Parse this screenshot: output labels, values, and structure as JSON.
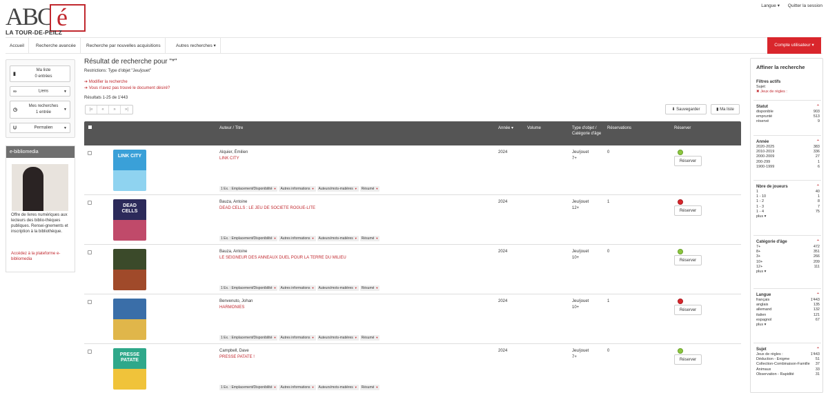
{
  "header": {
    "logo_text": "ABC",
    "logo_e": "é",
    "logo_subtitle": "LA TOUR-DE-PEILZ",
    "langue": "Langue ▾",
    "logout": "Quitter la session"
  },
  "nav": {
    "items": [
      "Accueil",
      "Recherche avancée",
      "Recherche par nouvelles acquisitions",
      "Autres recherches ▾"
    ],
    "account": "Compte utilisateur ▾"
  },
  "left": {
    "my_list_label": "Ma liste",
    "my_list_count": "0 entrées",
    "links": "Liens",
    "searches_label": "Mes recherches",
    "searches_count": "1 entrée",
    "permalink": "Permalien",
    "ebib_title": "e-bibliomedia",
    "ebib_text": "Offre de livres numériques aux lecteurs des biblio-thèques publiques. Rensei-gnements et inscription à la bibliothèque.",
    "ebib_link": "Accédez à la plateforme e-bibliomedia"
  },
  "main": {
    "title": "Résultat de recherche pour \"*\"",
    "restrictions": "Restrictions: Type d'objet \"Jeu/jouet\"",
    "modify": "➔ Modifier la recherche",
    "not_found": "➔ Vous n'avez pas trouvé le document désiré?",
    "results_count": "Résultats 1-25 de 1'443",
    "pager": [
      "|«",
      "«",
      "»",
      "»|"
    ],
    "save_btn": "⬇ Sauvegarder",
    "mylist_btn": "▮ Ma liste"
  },
  "table": {
    "headers": {
      "author": "Auteur / Titre",
      "year": "Année ▾",
      "volume": "Volume",
      "type": "Type d'objet / Catégorie d'âge",
      "reservations": "Réservations",
      "reserve": "Réserver"
    },
    "tag_labels": [
      "1 Ex. : Emplacement/Disponibilité",
      "Autres informations",
      "Auteurs/mots-matières",
      "Résumé"
    ],
    "reserve_btn": "Réserver",
    "rows": [
      {
        "author": "Alquier, Émilien",
        "title": "LINK CITY",
        "year": "2024",
        "type": "Jeu/jouet",
        "age": "7+",
        "res": "0",
        "status": "ok",
        "cover_text": "LINK CITY",
        "c1": "#3aa0d8",
        "c2": "#8fd3f0"
      },
      {
        "author": "Bauza, Antoine",
        "title": "DEAD CELLS : LE JEU DE SOCIETE ROGUE-LITE",
        "year": "2024",
        "type": "Jeu/jouet",
        "age": "12+",
        "res": "1",
        "status": "no",
        "cover_text": "DEAD CELLS",
        "c1": "#2c2a5a",
        "c2": "#c04a6a"
      },
      {
        "author": "Bauza, Antoine",
        "title": "LE SEIGNEUR DES ANNEAUX DUEL POUR LA TERRE DU MILIEU",
        "year": "2024",
        "type": "Jeu/jouet",
        "age": "10+",
        "res": "0",
        "status": "ok",
        "cover_text": "",
        "c1": "#3b4a2a",
        "c2": "#a04a2a"
      },
      {
        "author": "Benvenuto, Johan",
        "title": "HARMONIES",
        "year": "2024",
        "type": "Jeu/jouet",
        "age": "10+",
        "res": "1",
        "status": "no",
        "cover_text": "",
        "c1": "#3a6ea8",
        "c2": "#e0b64a"
      },
      {
        "author": "Campbell, Dave",
        "title": "PRESSE PATATE !",
        "year": "2024",
        "type": "Jeu/jouet",
        "age": "7+",
        "res": "0",
        "status": "ok",
        "cover_text": "PRESSE PATATE",
        "c1": "#2fa88a",
        "c2": "#f0c33a"
      }
    ]
  },
  "facets": {
    "title": "Affiner la recherche",
    "active_title": "Filtres actifs",
    "active_subject": "Sujet:",
    "active_value": "✖ Jeux de règles :",
    "sections": [
      {
        "name": "Statut",
        "items": [
          [
            "disponible",
            "903"
          ],
          [
            "emprunté",
            "513"
          ],
          [
            "réservé",
            "9"
          ]
        ],
        "more": ""
      },
      {
        "name": "Année",
        "items": [
          [
            "2020-2025",
            "383"
          ],
          [
            "2010-2019",
            "336"
          ],
          [
            "2000-2009",
            "27"
          ],
          [
            "200-299",
            "1"
          ],
          [
            "1900-1999",
            "6"
          ]
        ],
        "more": ""
      },
      {
        "name": "Nbre de joueurs",
        "items": [
          [
            "1",
            "40"
          ],
          [
            "1 - 10",
            "1"
          ],
          [
            "1 - 2",
            "8"
          ],
          [
            "1 - 3",
            "7"
          ],
          [
            "1 - 4",
            "75"
          ]
        ],
        "more": "plus ▾"
      },
      {
        "name": "Catégorie d'âge",
        "items": [
          [
            "7+",
            "472"
          ],
          [
            "8+",
            "351"
          ],
          [
            "3+",
            "266"
          ],
          [
            "10+",
            "209"
          ],
          [
            "12+",
            "111"
          ]
        ],
        "more": "plus ▾"
      },
      {
        "name": "Langue",
        "items": [
          [
            "français",
            "1'443"
          ],
          [
            "anglais",
            "135"
          ],
          [
            "allemand",
            "132"
          ],
          [
            "italien",
            "121"
          ],
          [
            "espagnol",
            "67"
          ]
        ],
        "more": "plus ▾"
      },
      {
        "name": "Sujet",
        "items": [
          [
            "Jeux de règles :",
            "1'443"
          ],
          [
            "Déduction - Enigme",
            "51"
          ],
          [
            "Collection-Combinaison-Famille",
            "37"
          ],
          [
            "Animaux",
            "33"
          ],
          [
            "Observation - Rapidité",
            "31"
          ]
        ],
        "more": ""
      }
    ]
  },
  "icons": {
    "bookmark": "bookmark-icon",
    "link": "link-icon",
    "history": "clock-icon",
    "permalink": "u-icon"
  }
}
